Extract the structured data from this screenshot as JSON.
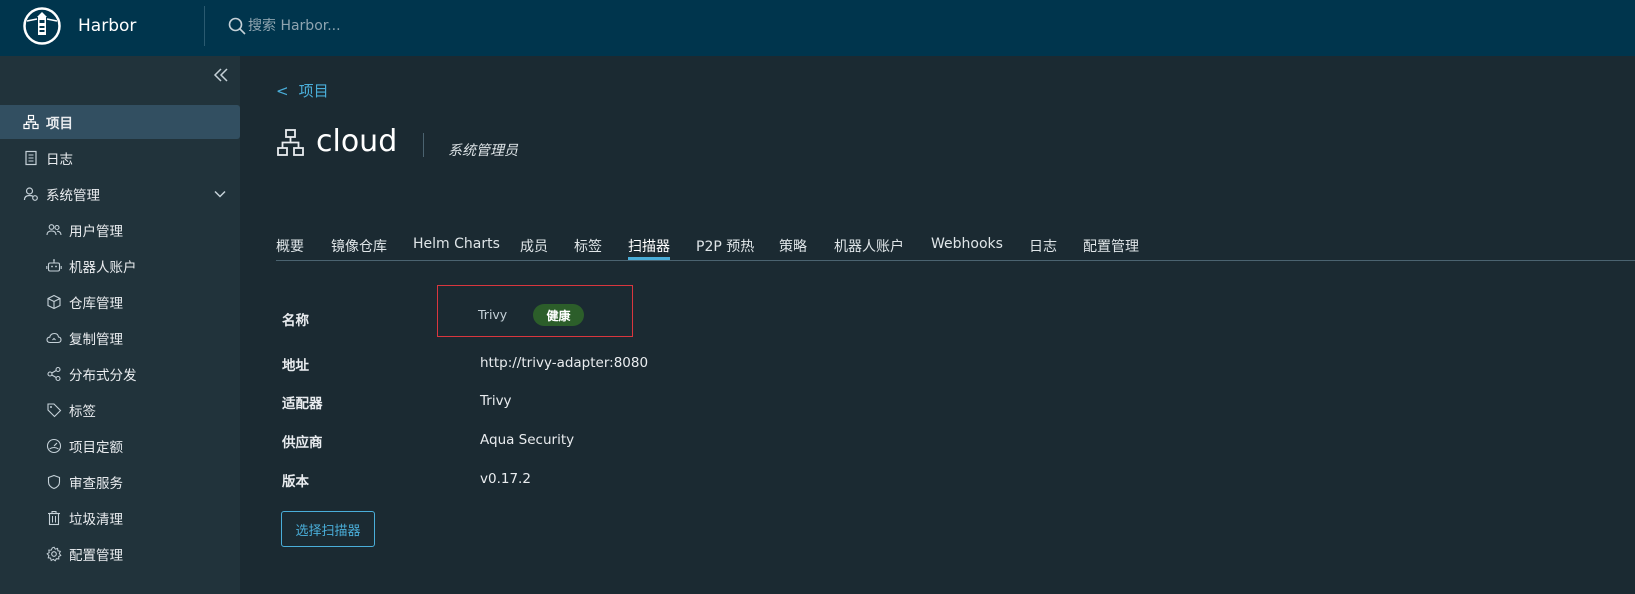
{
  "header": {
    "brand": "Harbor",
    "search": {
      "placeholder": "搜索 Harbor..."
    }
  },
  "sidebar": {
    "items": [
      {
        "label": "项目",
        "icon": "project-icon",
        "active": true
      },
      {
        "label": "日志",
        "icon": "log-icon"
      },
      {
        "label": "系统管理",
        "icon": "admin-icon",
        "expanded": true
      },
      {
        "label": "用户管理",
        "icon": "users-icon"
      },
      {
        "label": "机器人账户",
        "icon": "robot-icon"
      },
      {
        "label": "仓库管理",
        "icon": "box-icon"
      },
      {
        "label": "复制管理",
        "icon": "cloud-icon"
      },
      {
        "label": "分布式分发",
        "icon": "share-icon"
      },
      {
        "label": "标签",
        "icon": "tag-icon"
      },
      {
        "label": "项目定额",
        "icon": "gauge-icon"
      },
      {
        "label": "审查服务",
        "icon": "shield-icon"
      },
      {
        "label": "垃圾清理",
        "icon": "trash-icon"
      },
      {
        "label": "配置管理",
        "icon": "gear-icon"
      }
    ]
  },
  "main": {
    "back_label": "项目",
    "project_name": "cloud",
    "role": "系统管理员",
    "tabs": [
      {
        "label": "概要"
      },
      {
        "label": "镜像仓库"
      },
      {
        "label": "Helm Charts"
      },
      {
        "label": "成员"
      },
      {
        "label": "标签"
      },
      {
        "label": "扫描器",
        "active": true
      },
      {
        "label": "P2P 预热"
      },
      {
        "label": "策略"
      },
      {
        "label": "机器人账户"
      },
      {
        "label": "Webhooks"
      },
      {
        "label": "日志"
      },
      {
        "label": "配置管理"
      }
    ],
    "scanner": {
      "name_label": "名称",
      "name_value": "Trivy",
      "health_badge": "健康",
      "address_label": "地址",
      "address_value": "http://trivy-adapter:8080",
      "adapter_label": "适配器",
      "adapter_value": "Trivy",
      "vendor_label": "供应商",
      "vendor_value": "Aqua Security",
      "version_label": "版本",
      "version_value": "v0.17.2"
    },
    "select_button": "选择扫描器"
  },
  "colors": {
    "header_bg": "#00354d",
    "sidebar_bg": "#21333b",
    "main_bg": "#1b2a32",
    "accent": "#4aaed9",
    "badge_bg": "#2c5e2a",
    "highlight": "#d9363e"
  }
}
